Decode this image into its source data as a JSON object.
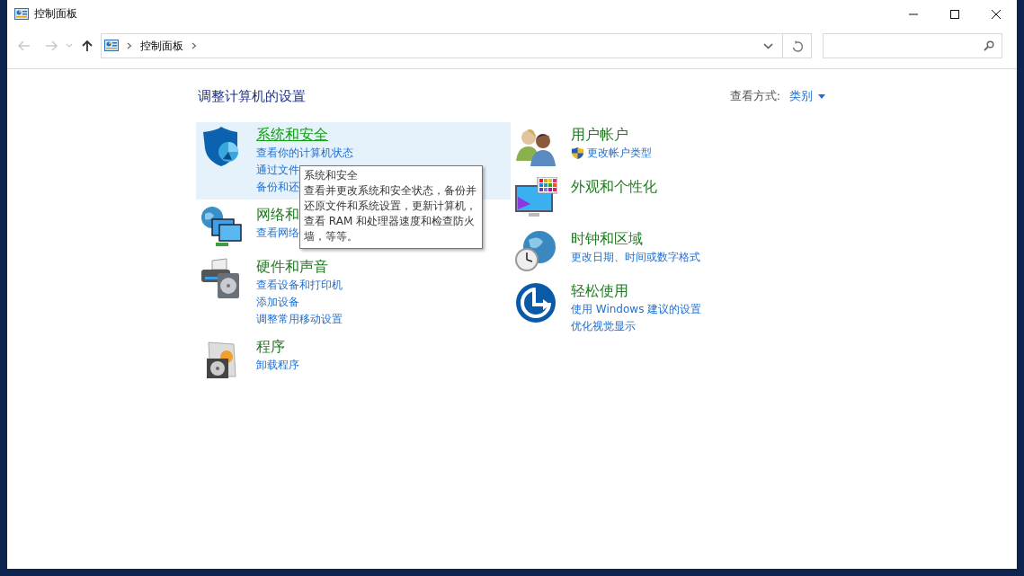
{
  "window": {
    "title": "控制面板"
  },
  "nav": [
    {
      "kind": "back",
      "disabled": true
    },
    {
      "kind": "forward",
      "disabled": true
    },
    {
      "kind": "recent",
      "disabled": true
    },
    {
      "kind": "up",
      "disabled": false
    }
  ],
  "address_bar": {
    "path": [
      "控制面板"
    ]
  },
  "header": {
    "title": "调整计算机的设置",
    "view_by_label": "查看方式:",
    "view_by_value": "类别"
  },
  "columns": [
    [
      {
        "title": "系统和安全",
        "highlighted": true,
        "links": [
          {
            "text": "查看你的计算机状态",
            "shield": false
          },
          {
            "text": "通过文件",
            "shield": false
          },
          {
            "text": "备份和还",
            "shield": false
          }
        ]
      },
      {
        "title": "网络和",
        "highlighted": false,
        "links": [
          {
            "text": "查看网络",
            "shield": false
          }
        ]
      },
      {
        "title": "硬件和声音",
        "highlighted": false,
        "links": [
          {
            "text": "查看设备和打印机",
            "shield": false
          },
          {
            "text": "添加设备",
            "shield": false
          },
          {
            "text": "调整常用移动设置",
            "shield": false
          }
        ]
      },
      {
        "title": "程序",
        "highlighted": false,
        "links": [
          {
            "text": "卸载程序",
            "shield": false
          }
        ]
      }
    ],
    [
      {
        "title": "用户帐户",
        "highlighted": false,
        "links": [
          {
            "text": "更改帐户类型",
            "shield": true
          }
        ]
      },
      {
        "title": "外观和个性化",
        "highlighted": false
      },
      {
        "title": "时钟和区域",
        "highlighted": false,
        "links": [
          {
            "text": "更改日期、时间或数字格式",
            "shield": false
          }
        ]
      },
      {
        "title": "轻松使用",
        "highlighted": false,
        "links": [
          {
            "text": "使用 Windows 建议的设置",
            "shield": false
          },
          {
            "text": "优化视觉显示",
            "shield": false
          }
        ]
      }
    ]
  ],
  "tooltip": {
    "title": "系统和安全",
    "lines": [
      "查看并更改系统和安全状态，备份并",
      "还原文件和系统设置，更新计算机，",
      "查看 RAM 和处理器速度和检查防火",
      "墙，等等。"
    ]
  }
}
